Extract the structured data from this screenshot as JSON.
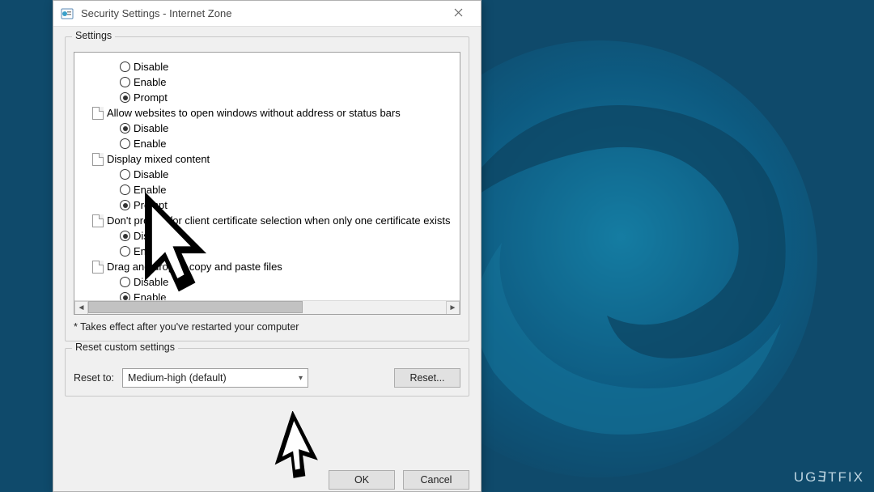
{
  "window": {
    "title": "Security Settings - Internet Zone"
  },
  "groupbox": {
    "settings_label": "Settings",
    "reset_label": "Reset custom settings"
  },
  "tree": {
    "g0": {
      "o0": "Disable",
      "o1": "Enable",
      "o2": "Prompt"
    },
    "g1": {
      "label": "Allow websites to open windows without address or status bars",
      "o0": "Disable",
      "o1": "Enable"
    },
    "g2": {
      "label": "Display mixed content",
      "o0": "Disable",
      "o1": "Enable",
      "o2": "Prompt"
    },
    "g3": {
      "label": "Don't prompt for client certificate selection when only one certificate exists",
      "o0": "Disable",
      "o1": "Enable"
    },
    "g4": {
      "label": "Drag and drop or copy and paste files",
      "o0": "Disable",
      "o1": "Enable"
    }
  },
  "footer_note": "* Takes effect after you've restarted your computer",
  "reset": {
    "label": "Reset to:",
    "selected": "Medium-high (default)",
    "button": "Reset..."
  },
  "buttons": {
    "ok": "OK",
    "cancel": "Cancel"
  },
  "watermark": "UG",
  "watermark2": "TFIX"
}
